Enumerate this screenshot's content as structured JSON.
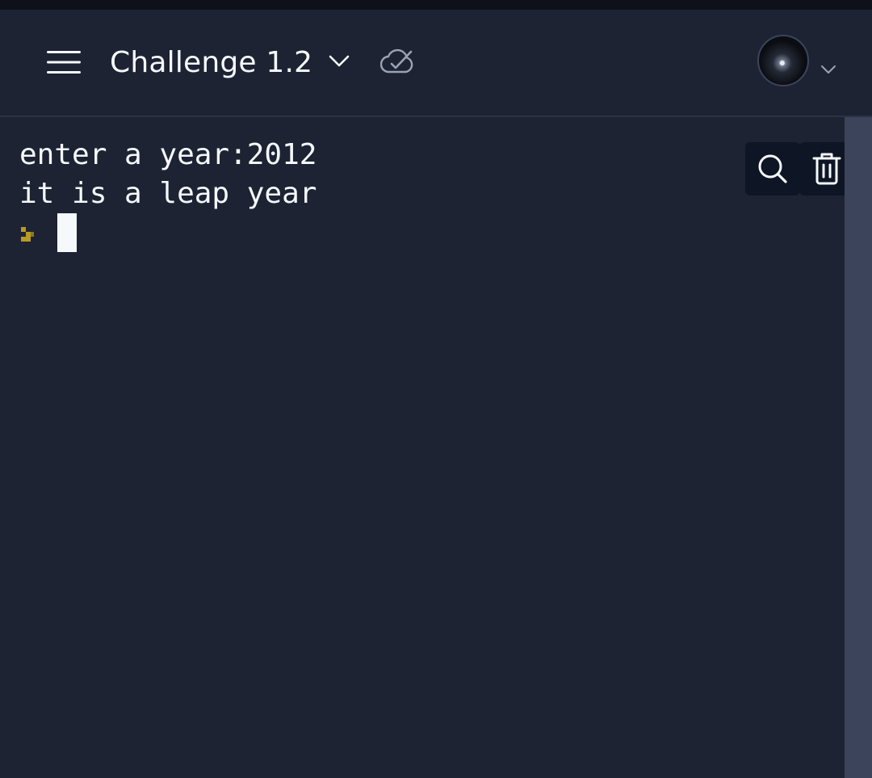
{
  "header": {
    "title": "Challenge 1.2",
    "icons": {
      "menu": "hamburger-menu-icon",
      "title_dropdown": "chevron-down-icon",
      "saved_status": "cloud-check-icon",
      "avatar": "user-avatar",
      "avatar_dropdown": "chevron-down-icon"
    }
  },
  "console": {
    "lines": [
      "enter a year:2012",
      "it is a leap year"
    ],
    "prompt_icon": "prompt-chevron-icon",
    "prompt_color": "#b89a24",
    "tools": {
      "search_icon": "search-icon",
      "clear_icon": "trash-icon"
    }
  },
  "colors": {
    "background": "#1d2333",
    "text": "#f5f9fc",
    "tool_button_bg": "#0e1525",
    "scrollbar": "#3c445c"
  }
}
